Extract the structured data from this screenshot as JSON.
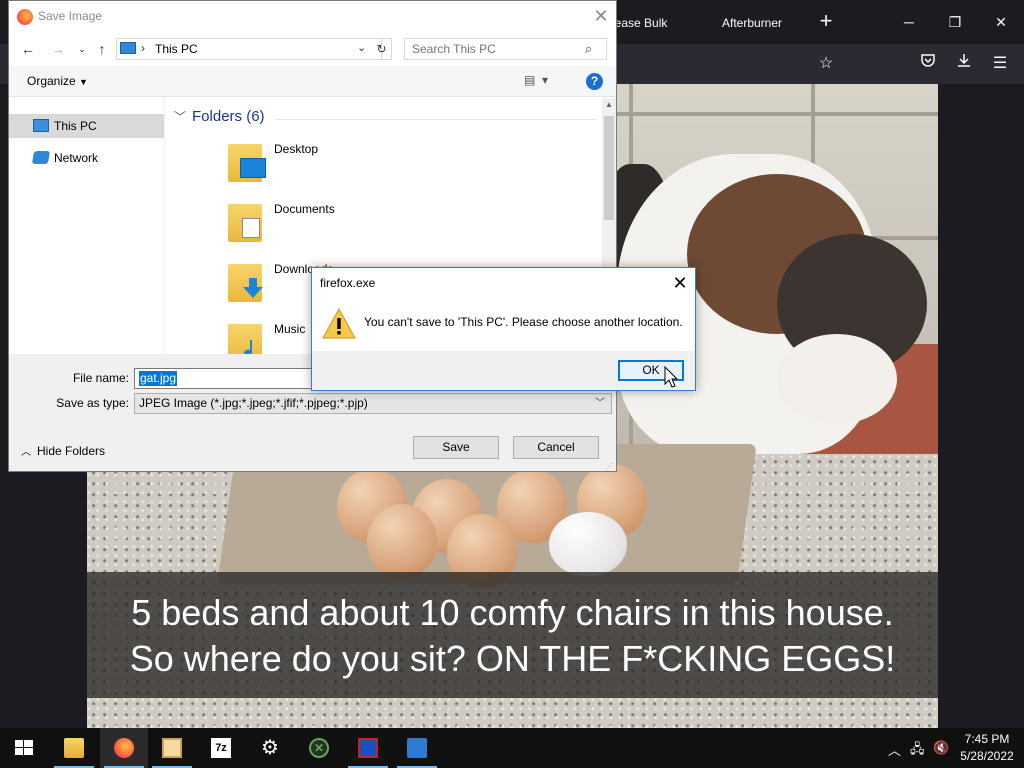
{
  "browser": {
    "tabs": [
      "lease Bulk",
      "Afterburner"
    ],
    "new_tab": "+",
    "window_controls": {
      "minimize": "─",
      "restore": "❐",
      "close": "✕"
    },
    "nav_icons": [
      "star-icon",
      "pocket-icon",
      "download-icon",
      "menu-icon"
    ]
  },
  "page": {
    "caption_line1": "5 beds and about 10 comfy chairs in this house.",
    "caption_line2": "So where do you sit? ON THE F*CKING EGGS!"
  },
  "save_dialog": {
    "title": "Save Image",
    "breadcrumb": "This PC",
    "search_placeholder": "Search This PC",
    "organize": "Organize",
    "sidebar": [
      {
        "label": "This PC",
        "icon": "computer-icon",
        "selected": true
      },
      {
        "label": "Network",
        "icon": "network-icon",
        "selected": false
      }
    ],
    "group_header": "Folders (6)",
    "folders": [
      {
        "label": "Desktop",
        "icon": "desktop-folder-icon"
      },
      {
        "label": "Documents",
        "icon": "documents-folder-icon"
      },
      {
        "label": "Downloads",
        "icon": "downloads-folder-icon"
      },
      {
        "label": "Music",
        "icon": "music-folder-icon"
      }
    ],
    "file_name_label": "File name:",
    "file_name_value": "gat.jpg",
    "save_type_label": "Save as type:",
    "save_type_value": "JPEG Image (*.jpg;*.jpeg;*.jfif;*.pjpeg;*.pjp)",
    "hide_folders": "Hide Folders",
    "save_button": "Save",
    "cancel_button": "Cancel"
  },
  "alert": {
    "title": "firefox.exe",
    "message": "You can't save to 'This PC'. Please choose another location.",
    "ok_button": "OK",
    "icon": "warning-icon"
  },
  "taskbar": {
    "time": "7:45 PM",
    "date": "5/28/2022",
    "apps": [
      "file-explorer-icon",
      "firefox-icon",
      "contacts-icon",
      "7zip-icon",
      "settings-icon",
      "xbox-icon",
      "monitor-app-icon",
      "network-tool-icon"
    ]
  },
  "colors": {
    "accent": "#0078d7",
    "taskbar": "#101010",
    "browser_bg": "#1c1b22",
    "folder_header": "#1e3287"
  }
}
